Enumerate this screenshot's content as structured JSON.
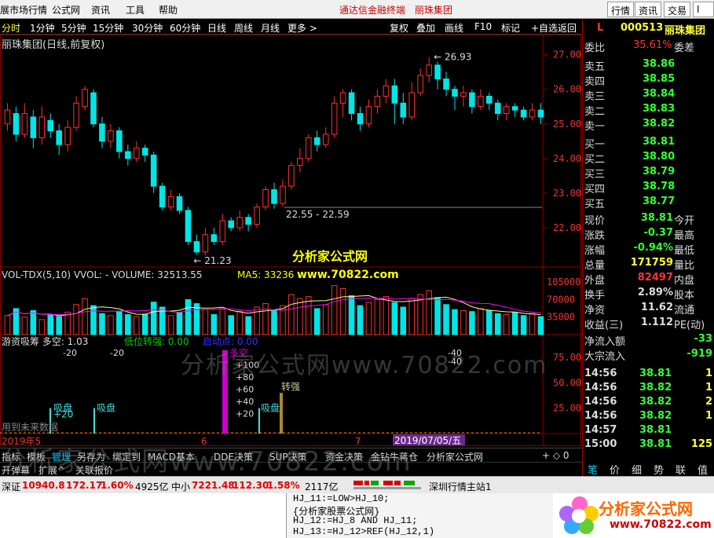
{
  "menu": {
    "market": "展市场行情",
    "formula": "公式网",
    "news": "资讯",
    "tools": "工具",
    "help": "帮助",
    "center1": "通达信金融终端",
    "center2": "丽珠集团",
    "btn_quote": "行情",
    "btn_news": "资讯",
    "btn_trade": "交易",
    "btn_more": "I"
  },
  "periods": [
    "分时",
    "1分钟",
    "5分钟",
    "15分钟",
    "30分钟",
    "60分钟",
    "日线",
    "周线",
    "月线",
    "更多 >"
  ],
  "right_tools": [
    "复权",
    "叠加",
    "画线",
    "F10",
    "标记",
    "+自选",
    "返回"
  ],
  "chart": {
    "title": "丽珠集团(日线,前复权)",
    "price_axis": [
      "27.00",
      "26.00",
      "25.00",
      "24.00",
      "23.00",
      "22.00"
    ],
    "annotation_high": "26.93",
    "annotation_low": "21.23",
    "annotation_range": "22.55 - 22.59",
    "center_label": "分析家公式网",
    "center_label_site": "www.70822.com",
    "vol_header": "VOL-TDX(5,10) VVOL: -   VOLUME: 32513.55",
    "ma5": "MA5: 33236",
    "vol_axis": [
      "105000",
      "70000",
      "35000"
    ],
    "ind_header_left": "游资吸筹 多空: 1.03",
    "ind_header_mid": "低位转强: 0.00",
    "ind_header_right": "启动点: 0.00",
    "ind_axis": [
      "75.00",
      "50.00",
      "25.00"
    ],
    "ind_left_marks": "-20",
    "ind_left_marks2": "-20",
    "ind_mid_marks": "-40",
    "ind_mid_marks2": "-40",
    "ind_labels": {
      "xipan1": "吸盘",
      "xipan1_val": "+20",
      "xipan2": "吸盘",
      "duokong": "多空",
      "duokong_vals": [
        "+100",
        "+80",
        "+60",
        "+40",
        "+20"
      ],
      "xipan3": "吸盘",
      "zhuanqiang": "转强",
      "future": "用到未来数据"
    },
    "date_labels": {
      "m1": "2019年5",
      "m2": "6",
      "m3": "7",
      "cursor": "2019/07/05/五"
    }
  },
  "candles": [
    {
      "o": 25.0,
      "c": 25.4,
      "h": 25.6,
      "l": 24.8
    },
    {
      "o": 25.3,
      "c": 24.7,
      "h": 25.5,
      "l": 24.5
    },
    {
      "o": 24.7,
      "c": 25.3,
      "h": 25.6,
      "l": 24.6
    },
    {
      "o": 25.2,
      "c": 24.6,
      "h": 25.4,
      "l": 24.3
    },
    {
      "o": 24.6,
      "c": 25.2,
      "h": 25.5,
      "l": 24.4
    },
    {
      "o": 25.1,
      "c": 24.8,
      "h": 25.3,
      "l": 24.6
    },
    {
      "o": 24.8,
      "c": 24.4,
      "h": 25.0,
      "l": 24.1
    },
    {
      "o": 24.4,
      "c": 24.9,
      "h": 25.1,
      "l": 24.2
    },
    {
      "o": 24.9,
      "c": 25.6,
      "h": 25.8,
      "l": 24.8
    },
    {
      "o": 25.5,
      "c": 26.0,
      "h": 26.1,
      "l": 25.4
    },
    {
      "o": 25.9,
      "c": 25.0,
      "h": 26.0,
      "l": 24.9
    },
    {
      "o": 25.0,
      "c": 24.5,
      "h": 25.2,
      "l": 24.3
    },
    {
      "o": 24.5,
      "c": 24.8,
      "h": 25.0,
      "l": 24.3
    },
    {
      "o": 24.8,
      "c": 24.2,
      "h": 24.9,
      "l": 24.0
    },
    {
      "o": 24.2,
      "c": 24.0,
      "h": 24.4,
      "l": 23.8
    },
    {
      "o": 24.0,
      "c": 24.3,
      "h": 24.5,
      "l": 23.9
    },
    {
      "o": 24.3,
      "c": 24.1,
      "h": 24.4,
      "l": 23.9
    },
    {
      "o": 24.1,
      "c": 23.2,
      "h": 24.2,
      "l": 23.0
    },
    {
      "o": 23.2,
      "c": 22.6,
      "h": 23.3,
      "l": 22.5
    },
    {
      "o": 22.6,
      "c": 22.9,
      "h": 23.1,
      "l": 22.5
    },
    {
      "o": 22.9,
      "c": 22.5,
      "h": 23.0,
      "l": 22.4
    },
    {
      "o": 22.5,
      "c": 21.6,
      "h": 22.6,
      "l": 21.5
    },
    {
      "o": 21.6,
      "c": 21.3,
      "h": 21.8,
      "l": 21.23
    },
    {
      "o": 21.3,
      "c": 21.8,
      "h": 22.0,
      "l": 21.2
    },
    {
      "o": 21.8,
      "c": 21.6,
      "h": 22.0,
      "l": 21.5
    },
    {
      "o": 21.6,
      "c": 22.2,
      "h": 22.4,
      "l": 21.5
    },
    {
      "o": 22.2,
      "c": 22.0,
      "h": 22.3,
      "l": 21.9
    },
    {
      "o": 22.0,
      "c": 22.3,
      "h": 22.5,
      "l": 21.9
    },
    {
      "o": 22.3,
      "c": 22.1,
      "h": 22.4,
      "l": 21.9
    },
    {
      "o": 22.1,
      "c": 22.6,
      "h": 22.7,
      "l": 22.0
    },
    {
      "o": 22.6,
      "c": 23.1,
      "h": 23.2,
      "l": 22.5
    },
    {
      "o": 23.1,
      "c": 22.7,
      "h": 23.3,
      "l": 22.55
    },
    {
      "o": 22.7,
      "c": 23.2,
      "h": 23.4,
      "l": 22.6
    },
    {
      "o": 23.2,
      "c": 23.8,
      "h": 23.9,
      "l": 23.1
    },
    {
      "o": 23.8,
      "c": 24.0,
      "h": 24.3,
      "l": 23.6
    },
    {
      "o": 24.0,
      "c": 24.6,
      "h": 24.7,
      "l": 23.9
    },
    {
      "o": 24.6,
      "c": 24.4,
      "h": 24.8,
      "l": 24.2
    },
    {
      "o": 24.4,
      "c": 24.7,
      "h": 24.9,
      "l": 24.3
    },
    {
      "o": 24.7,
      "c": 25.6,
      "h": 25.8,
      "l": 24.6
    },
    {
      "o": 25.6,
      "c": 25.9,
      "h": 26.0,
      "l": 25.2
    },
    {
      "o": 25.9,
      "c": 25.3,
      "h": 26.0,
      "l": 25.1
    },
    {
      "o": 25.3,
      "c": 25.0,
      "h": 25.5,
      "l": 24.8
    },
    {
      "o": 25.0,
      "c": 25.5,
      "h": 25.7,
      "l": 24.9
    },
    {
      "o": 25.5,
      "c": 25.8,
      "h": 26.0,
      "l": 25.3
    },
    {
      "o": 25.8,
      "c": 26.1,
      "h": 26.3,
      "l": 25.6
    },
    {
      "o": 26.1,
      "c": 25.6,
      "h": 26.3,
      "l": 25.0
    },
    {
      "o": 25.6,
      "c": 25.2,
      "h": 25.9,
      "l": 25.0
    },
    {
      "o": 25.2,
      "c": 25.9,
      "h": 26.2,
      "l": 25.1
    },
    {
      "o": 25.9,
      "c": 26.4,
      "h": 26.6,
      "l": 25.8
    },
    {
      "o": 26.4,
      "c": 26.7,
      "h": 26.93,
      "l": 26.2
    },
    {
      "o": 26.7,
      "c": 26.3,
      "h": 26.8,
      "l": 26.0
    },
    {
      "o": 26.3,
      "c": 26.0,
      "h": 26.5,
      "l": 25.8
    },
    {
      "o": 26.0,
      "c": 25.8,
      "h": 26.1,
      "l": 25.4
    },
    {
      "o": 25.8,
      "c": 25.9,
      "h": 26.1,
      "l": 25.5
    },
    {
      "o": 25.9,
      "c": 25.5,
      "h": 26.0,
      "l": 25.3
    },
    {
      "o": 25.5,
      "c": 25.8,
      "h": 26.0,
      "l": 25.4
    },
    {
      "o": 25.8,
      "c": 25.6,
      "h": 25.9,
      "l": 25.4
    },
    {
      "o": 25.6,
      "c": 25.3,
      "h": 25.7,
      "l": 25.1
    },
    {
      "o": 25.3,
      "c": 25.5,
      "h": 25.6,
      "l": 25.1
    },
    {
      "o": 25.5,
      "c": 25.4,
      "h": 25.6,
      "l": 25.2
    },
    {
      "o": 25.4,
      "c": 25.2,
      "h": 25.5,
      "l": 25.1
    },
    {
      "o": 25.2,
      "c": 25.4,
      "h": 25.6,
      "l": 25.1
    },
    {
      "o": 25.4,
      "c": 25.2,
      "h": 25.6,
      "l": 25.0
    }
  ],
  "volumes": [
    38000,
    52000,
    35000,
    48000,
    30000,
    40000,
    36000,
    45000,
    60000,
    72000,
    58000,
    42000,
    38000,
    47000,
    40000,
    36000,
    41000,
    65000,
    55000,
    38000,
    44000,
    70000,
    62000,
    50000,
    40000,
    52000,
    38000,
    47000,
    36000,
    55000,
    62000,
    48000,
    58000,
    80000,
    72000,
    76000,
    52000,
    60000,
    98000,
    92000,
    78000,
    58000,
    64000,
    70000,
    76000,
    64000,
    55000,
    72000,
    80000,
    88000,
    74000,
    60000,
    50000,
    48000,
    46000,
    52000,
    48000,
    42000,
    40000,
    44000,
    38000,
    42000,
    36000
  ],
  "tabs": [
    "指标",
    "模板",
    "管理",
    "另存为",
    "绑定到",
    "MACD基本",
    "DDE决策",
    "SUP决策",
    "资金决策",
    "金钻牛蒋仓",
    "分析家公式网"
  ],
  "subtabs": [
    "开弹幕",
    "扩展^",
    "关联报价"
  ],
  "stock": {
    "flag": "L",
    "code": "000513",
    "name": "丽珠集团",
    "weibi_label": "委比",
    "weibi": "35.61%",
    "weicha_label": "委差",
    "sells": [
      {
        "label": "卖五",
        "price": "38.86"
      },
      {
        "label": "卖四",
        "price": "38.85"
      },
      {
        "label": "卖三",
        "price": "38.84"
      },
      {
        "label": "卖二",
        "price": "38.83"
      },
      {
        "label": "卖一",
        "price": "38.82"
      }
    ],
    "buys": [
      {
        "label": "买一",
        "price": "38.81"
      },
      {
        "label": "买二",
        "price": "38.80"
      },
      {
        "label": "买三",
        "price": "38.79"
      },
      {
        "label": "买四",
        "price": "38.78"
      },
      {
        "label": "买五",
        "price": "38.77"
      }
    ],
    "stats": [
      {
        "l": "现价",
        "v": "38.81",
        "r": "今开",
        "c": "#3f3"
      },
      {
        "l": "涨跌",
        "v": "-0.37",
        "r": "最高",
        "c": "#3f3"
      },
      {
        "l": "涨幅",
        "v": "-0.94%",
        "r": "最低",
        "c": "#3f3"
      },
      {
        "l": "总量",
        "v": "171759",
        "r": "量比",
        "c": "#ff3"
      },
      {
        "l": "外盘",
        "v": "82497",
        "r": "内盘",
        "c": "#f33"
      },
      {
        "l": "换手",
        "v": "2.89%",
        "r": "股本",
        "c": "#ddd"
      },
      {
        "l": "净资",
        "v": "11.62",
        "r": "流通",
        "c": "#ddd"
      },
      {
        "l": "收益(三)",
        "v": "1.112",
        "r": "PE(动)",
        "c": "#ddd"
      }
    ],
    "flow": [
      {
        "l": "净流入额",
        "v": "-33"
      },
      {
        "l": "大宗流入",
        "v": "-919"
      }
    ],
    "ticks": [
      {
        "t": "14:56",
        "p": "38.81",
        "v": "1",
        "c": "#3f3"
      },
      {
        "t": "14:56",
        "p": "38.82",
        "v": "1",
        "c": "#3f3"
      },
      {
        "t": "14:56",
        "p": "38.82",
        "v": "2",
        "c": "#3f3"
      },
      {
        "t": "14:56",
        "p": "38.82",
        "v": "1",
        "c": "#3f3"
      },
      {
        "t": "14:57",
        "p": "38.81",
        "v": "",
        "c": "#3f3"
      },
      {
        "t": "15:00",
        "p": "38.81",
        "v": "125",
        "c": "#3f3"
      }
    ],
    "bottom_tabs": [
      "笔",
      "价",
      "细",
      "势",
      "联",
      "值"
    ]
  },
  "status": {
    "sz_label": "深证",
    "sz_val": "10940.8",
    "sz_chg": "172.17",
    "sz_pct": "1.60%",
    "sz_amt": "4925亿",
    "zx_label": "中小",
    "zx_val": "7221.48",
    "zx_chg": "112.30",
    "zx_pct": "1.58%",
    "zx_amt": "2117亿",
    "server": "深圳行情主站1"
  },
  "code": {
    "line1": "HJ_11:=LOW>HJ_10;",
    "line2": "{分析家股票公式网}",
    "line3": "HJ_12:=HJ_8 AND HJ_11;",
    "line4": "HJ_13:=HJ_12>REF(HJ_12,1)"
  },
  "logo": {
    "text": "分析家公式网",
    "site": "www.70822.com"
  },
  "watermark": {
    "text1": "分析家公式网www.70822.com",
    "text2": "分析家公式网www.70822.com"
  },
  "colors": {
    "up": "#ff3030",
    "down": "#00e5e5",
    "grid": "#8b0000",
    "ma5": "#ffff80",
    "ma10": "#ff00ff"
  }
}
